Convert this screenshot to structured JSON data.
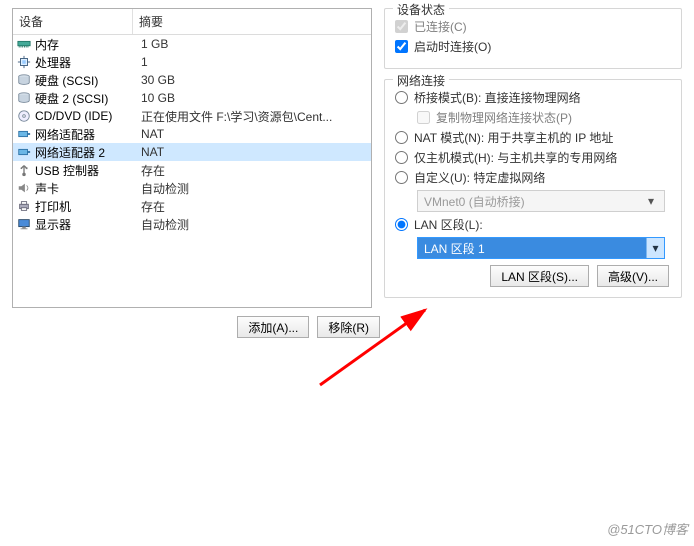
{
  "headers": {
    "device": "设备",
    "summary": "摘要"
  },
  "devices": [
    {
      "name": "内存",
      "summary": "1 GB",
      "icon": "memory"
    },
    {
      "name": "处理器",
      "summary": "1",
      "icon": "cpu"
    },
    {
      "name": "硬盘 (SCSI)",
      "summary": "30 GB",
      "icon": "disk"
    },
    {
      "name": "硬盘 2 (SCSI)",
      "summary": "10 GB",
      "icon": "disk"
    },
    {
      "name": "CD/DVD (IDE)",
      "summary": "正在使用文件 F:\\学习\\资源包\\Cent...",
      "icon": "cd"
    },
    {
      "name": "网络适配器",
      "summary": "NAT",
      "icon": "net"
    },
    {
      "name": "网络适配器 2",
      "summary": "NAT",
      "icon": "net",
      "selected": true
    },
    {
      "name": "USB 控制器",
      "summary": "存在",
      "icon": "usb"
    },
    {
      "name": "声卡",
      "summary": "自动检测",
      "icon": "sound"
    },
    {
      "name": "打印机",
      "summary": "存在",
      "icon": "printer"
    },
    {
      "name": "显示器",
      "summary": "自动检测",
      "icon": "display"
    }
  ],
  "left_buttons": {
    "add": "添加(A)...",
    "remove": "移除(R)"
  },
  "status_group": {
    "legend": "设备状态",
    "connected_label": "已连接(C)",
    "connected_checked": true,
    "connected_enabled": false,
    "on_start_label": "启动时连接(O)",
    "on_start_checked": true
  },
  "net_group": {
    "legend": "网络连接",
    "bridged": "桥接模式(B): 直接连接物理网络",
    "replicate": "复制物理网络连接状态(P)",
    "nat": "NAT 模式(N): 用于共享主机的 IP 地址",
    "host_only": "仅主机模式(H): 与主机共享的专用网络",
    "custom": "自定义(U): 特定虚拟网络",
    "custom_value": "VMnet0 (自动桥接)",
    "lan_seg": "LAN 区段(L):",
    "lan_value": "LAN 区段 1",
    "selected": "lan"
  },
  "right_buttons": {
    "lan": "LAN 区段(S)...",
    "adv": "高级(V)..."
  },
  "watermark": "@51CTO博客"
}
